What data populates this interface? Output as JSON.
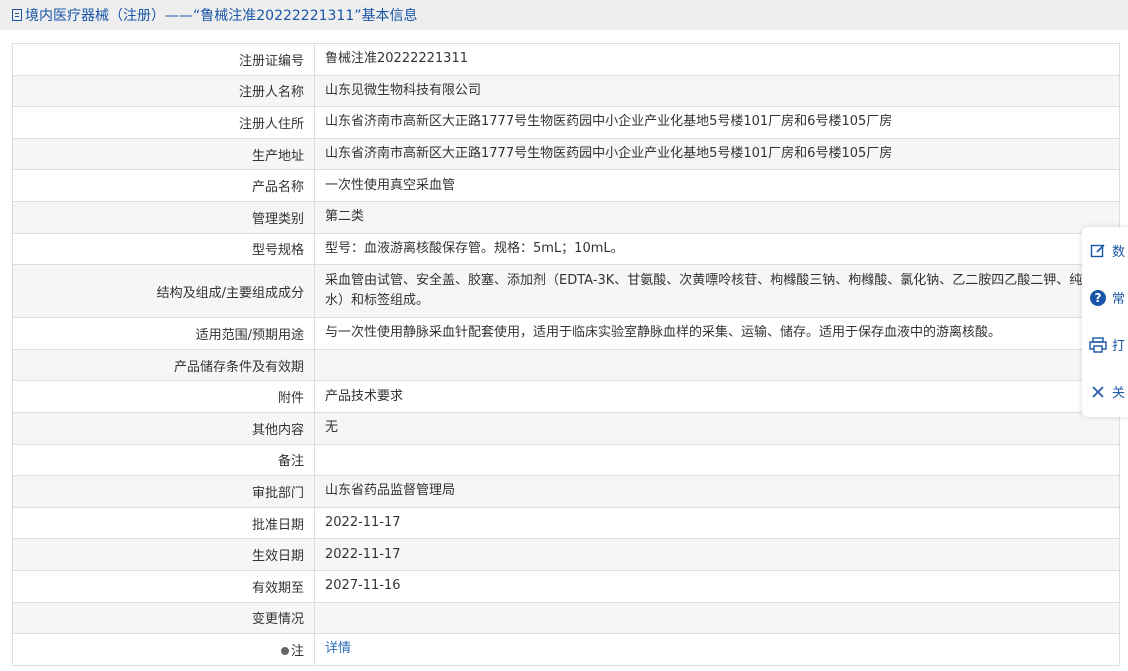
{
  "header": {
    "title": "境内医疗器械（注册）——“鲁械注准20222221311”基本信息"
  },
  "rows": [
    {
      "label": "注册证编号",
      "value": "鲁械注准20222221311"
    },
    {
      "label": "注册人名称",
      "value": "山东见微生物科技有限公司"
    },
    {
      "label": "注册人住所",
      "value": "山东省济南市高新区大正路1777号生物医药园中小企业产业化基地5号楼101厂房和6号楼105厂房"
    },
    {
      "label": "生产地址",
      "value": "山东省济南市高新区大正路1777号生物医药园中小企业产业化基地5号楼101厂房和6号楼105厂房"
    },
    {
      "label": "产品名称",
      "value": "一次性使用真空采血管"
    },
    {
      "label": "管理类别",
      "value": "第二类"
    },
    {
      "label": "型号规格",
      "value": "型号：血液游离核酸保存管。规格：5mL；10mL。"
    },
    {
      "label": "结构及组成/主要组成成分",
      "value": "采血管由试管、安全盖、胶塞、添加剂（EDTA-3K、甘氨酸、次黄嘌呤核苷、枸橼酸三钠、枸橼酸、氯化钠、乙二胺四乙酸二钾、纯水）和标签组成。"
    },
    {
      "label": "适用范围/预期用途",
      "value": "与一次性使用静脉采血针配套使用，适用于临床实验室静脉血样的采集、运输、储存。适用于保存血液中的游离核酸。"
    },
    {
      "label": "产品储存条件及有效期",
      "value": ""
    },
    {
      "label": "附件",
      "value": "产品技术要求"
    },
    {
      "label": "其他内容",
      "value": "无"
    },
    {
      "label": "备注",
      "value": ""
    },
    {
      "label": "审批部门",
      "value": "山东省药品监督管理局"
    },
    {
      "label": "批准日期",
      "value": "2022-11-17"
    },
    {
      "label": "生效日期",
      "value": "2022-11-17"
    },
    {
      "label": "有效期至",
      "value": "2027-11-16"
    },
    {
      "label": "变更情况",
      "value": ""
    }
  ],
  "note_row": {
    "label": "注",
    "link": "详情"
  },
  "float_panel": [
    {
      "label": "数",
      "icon": "edit-icon"
    },
    {
      "label": "常",
      "icon": "help-icon"
    },
    {
      "label": "打",
      "icon": "print-icon"
    },
    {
      "label": "关",
      "icon": "close-icon"
    }
  ]
}
